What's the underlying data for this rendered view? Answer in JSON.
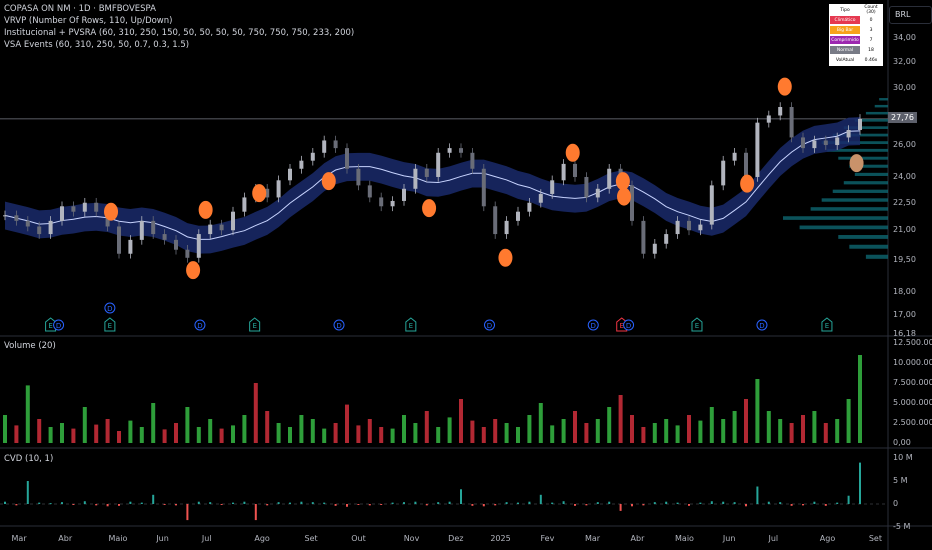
{
  "header": {
    "symbol": "COPASA ON NM · 1D · BMFBOVESPA",
    "indicators": [
      "VRVP (Number Of Rows, 110, Up/Down)",
      "Institucional + PVSRA (60, 310, 250, 150, 50, 50, 50, 50, 750, 750, 750, 233, 200)",
      "VSA Events (60, 310, 250, 50, 0.7, 0.3, 1.5)"
    ]
  },
  "currency": "BRL",
  "last_price": "27,76",
  "vsa_table": {
    "header": [
      "Tipo",
      "Count (30)"
    ],
    "rows": [
      {
        "label": "Climático",
        "count": "0",
        "color": "#e53950"
      },
      {
        "label": "Big Bar",
        "count": "3",
        "color": "#f7a21b"
      },
      {
        "label": "Comprimido",
        "count": "7",
        "color": "#9c27b0"
      },
      {
        "label": "Normal",
        "count": "18",
        "color": "#787b86"
      }
    ],
    "footer": {
      "label": "VolAtual",
      "value": "0.46x"
    }
  },
  "volume_pane": {
    "title": "Volume (20)",
    "ticks": [
      "12.500.000,00",
      "10.000.000,00",
      "7.500.000,00",
      "5.000.000,00",
      "2.500.000,00",
      "0,00"
    ]
  },
  "cvd_pane": {
    "title": "CVD (10, 1)",
    "ticks": [
      "10 M",
      "5 M",
      "0",
      "-5 M"
    ]
  },
  "chart_data": [
    {
      "type": "candlestick",
      "scale": "log",
      "ylim": [
        16.18,
        35.5
      ],
      "y_ticks": [
        "34,00",
        "32,00",
        "30,00",
        "26,00",
        "24,00",
        "22,50",
        "21,00",
        "19,50",
        "18,00",
        "17,00",
        "16,18"
      ],
      "y_tick_values": [
        34,
        32,
        30,
        26,
        24,
        22.5,
        21,
        19.5,
        18,
        17,
        16.18
      ],
      "x_ticks": [
        "Mar",
        "Abr",
        "Maio",
        "Jun",
        "Jul",
        "Ago",
        "Set",
        "Out",
        "Nov",
        "Dez",
        "2025",
        "Fev",
        "Mar",
        "Abr",
        "Maio",
        "Jun",
        "Jul",
        "Ago",
        "Set"
      ],
      "x_tick_bar_index": [
        1.1,
        5.2,
        9.6,
        13.8,
        17.8,
        22.4,
        26.8,
        30.9,
        35.5,
        39.4,
        43.1,
        47.5,
        51.4,
        55.4,
        59.3,
        63.5,
        67.5,
        72,
        76.3
      ],
      "closes": [
        21.8,
        21.5,
        21.2,
        20.8,
        21.5,
        22.3,
        22.0,
        22.5,
        22.0,
        21.2,
        19.8,
        20.5,
        21.5,
        20.8,
        20.5,
        20.0,
        19.6,
        20.8,
        21.3,
        21.0,
        22.0,
        22.8,
        23.3,
        22.8,
        23.8,
        24.5,
        25.0,
        25.5,
        26.3,
        25.8,
        24.5,
        23.5,
        22.8,
        22.3,
        22.6,
        23.3,
        24.5,
        24.0,
        25.5,
        25.8,
        25.5,
        24.5,
        22.3,
        20.8,
        21.5,
        22.0,
        22.5,
        23.0,
        23.8,
        24.8,
        24.0,
        22.8,
        23.3,
        24.5,
        23.5,
        21.5,
        19.8,
        20.3,
        20.8,
        21.5,
        21.0,
        21.3,
        23.5,
        25.0,
        25.5,
        24.0,
        27.5,
        28.0,
        28.6,
        26.5,
        25.8,
        26.3,
        26.0,
        26.5,
        27.0,
        27.76
      ],
      "vsa_events": [
        {
          "bar": 9.3,
          "price": 22.0,
          "color": "#ff7a2f"
        },
        {
          "bar": 16.5,
          "price": 19.0,
          "color": "#ff7a2f"
        },
        {
          "bar": 17.6,
          "price": 22.1,
          "color": "#ff7a2f"
        },
        {
          "bar": 22.3,
          "price": 23.05,
          "color": "#ff7a2f"
        },
        {
          "bar": 28.4,
          "price": 23.75,
          "color": "#ff7a2f"
        },
        {
          "bar": 37.2,
          "price": 22.2,
          "color": "#ff7a2f"
        },
        {
          "bar": 43.9,
          "price": 19.6,
          "color": "#ff7a2f"
        },
        {
          "bar": 49.8,
          "price": 25.5,
          "color": "#ff7a2f"
        },
        {
          "bar": 54.2,
          "price": 23.75,
          "color": "#ff7a2f"
        },
        {
          "bar": 54.3,
          "price": 22.85,
          "color": "#ff7a2f"
        },
        {
          "bar": 65.1,
          "price": 23.6,
          "color": "#ff7a2f"
        },
        {
          "bar": 68.4,
          "price": 30.1,
          "color": "#ff7a2f"
        },
        {
          "bar": 74.7,
          "price": 24.85,
          "color": "#c9926a"
        }
      ],
      "corporate_events": [
        {
          "bar": 4,
          "type": "E"
        },
        {
          "bar": 4.7,
          "type": "D"
        },
        {
          "bar": 9.2,
          "type": "D",
          "upper": true
        },
        {
          "bar": 9.2,
          "type": "E"
        },
        {
          "bar": 17.1,
          "type": "D"
        },
        {
          "bar": 21.9,
          "type": "E"
        },
        {
          "bar": 29.3,
          "type": "D"
        },
        {
          "bar": 35.6,
          "type": "E"
        },
        {
          "bar": 42.5,
          "type": "D"
        },
        {
          "bar": 51.6,
          "type": "D"
        },
        {
          "bar": 54.1,
          "type": "E",
          "highlight": true
        },
        {
          "bar": 54.7,
          "type": "D"
        },
        {
          "bar": 60.7,
          "type": "E"
        },
        {
          "bar": 66.4,
          "type": "D"
        },
        {
          "bar": 72.1,
          "type": "E"
        }
      ],
      "vrvp": {
        "prices": [
          19.5,
          20,
          20.5,
          21,
          21.5,
          22,
          22.5,
          23,
          23.5,
          24,
          24.5,
          25,
          25.5,
          26,
          26.5,
          27,
          27.5,
          28,
          28.5,
          29
        ],
        "volumes": [
          20,
          35,
          45,
          80,
          95,
          70,
          60,
          50,
          40,
          30,
          35,
          45,
          55,
          60,
          50,
          40,
          30,
          20,
          12,
          8
        ]
      }
    },
    {
      "type": "bar",
      "name": "Volume (20)",
      "unit": "BRL",
      "ylim": [
        0,
        12500000
      ],
      "values_millions": [
        3.5,
        2.2,
        7.2,
        3.0,
        2.0,
        2.5,
        1.8,
        4.5,
        2.3,
        3.0,
        1.5,
        2.8,
        2.0,
        5.0,
        1.7,
        2.5,
        4.5,
        2.0,
        3.0,
        1.8,
        2.2,
        3.5,
        7.5,
        4.0,
        2.5,
        2.0,
        3.5,
        3.0,
        1.8,
        2.5,
        4.8,
        2.2,
        3.0,
        2.0,
        1.8,
        3.5,
        2.5,
        4.0,
        2.0,
        3.2,
        5.5,
        2.8,
        2.0,
        3.0,
        2.5,
        2.0,
        3.5,
        5.0,
        2.2,
        3.0,
        4.0,
        2.5,
        3.0,
        4.5,
        6.0,
        3.5,
        2.0,
        2.5,
        3.0,
        2.2,
        3.5,
        2.8,
        4.5,
        3.0,
        4.0,
        5.5,
        8.0,
        4.0,
        3.0,
        2.5,
        3.5,
        4.0,
        2.5,
        3.0,
        5.5,
        11.0
      ],
      "up": [
        1,
        0,
        1,
        0,
        1,
        1,
        0,
        1,
        0,
        0,
        0,
        1,
        1,
        1,
        0,
        0,
        1,
        1,
        1,
        0,
        1,
        1,
        0,
        0,
        1,
        1,
        1,
        1,
        1,
        0,
        0,
        0,
        0,
        0,
        1,
        1,
        1,
        0,
        1,
        1,
        0,
        0,
        0,
        0,
        1,
        1,
        1,
        1,
        1,
        1,
        0,
        0,
        1,
        1,
        0,
        0,
        0,
        1,
        1,
        1,
        0,
        1,
        1,
        1,
        1,
        0,
        1,
        1,
        1,
        0,
        0,
        1,
        0,
        1,
        1,
        1
      ]
    },
    {
      "type": "bar",
      "name": "CVD (10, 1)",
      "ylim": [
        -6.5,
        10.5
      ],
      "values_millions": [
        0.5,
        -0.3,
        5.0,
        0.3,
        0.2,
        0.4,
        -0.2,
        0.6,
        -0.3,
        -0.5,
        -0.4,
        0.5,
        0.3,
        2.0,
        -0.2,
        -0.3,
        -3.5,
        0.5,
        0.4,
        -0.2,
        0.3,
        0.5,
        -3.5,
        -0.3,
        0.4,
        0.3,
        0.5,
        0.4,
        0.3,
        -0.4,
        -0.6,
        -0.2,
        -0.3,
        -0.2,
        0.3,
        0.4,
        0.5,
        -0.3,
        0.4,
        0.5,
        3.2,
        -0.4,
        -0.5,
        -0.3,
        0.4,
        0.3,
        0.5,
        2.0,
        0.3,
        0.6,
        -0.4,
        -0.3,
        0.4,
        0.5,
        -1.5,
        -0.5,
        -0.3,
        0.4,
        0.5,
        0.3,
        -0.4,
        0.3,
        0.6,
        0.5,
        0.4,
        -0.5,
        3.8,
        0.5,
        0.4,
        -0.4,
        -0.3,
        0.5,
        -0.4,
        0.3,
        1.8,
        9.0
      ]
    }
  ]
}
